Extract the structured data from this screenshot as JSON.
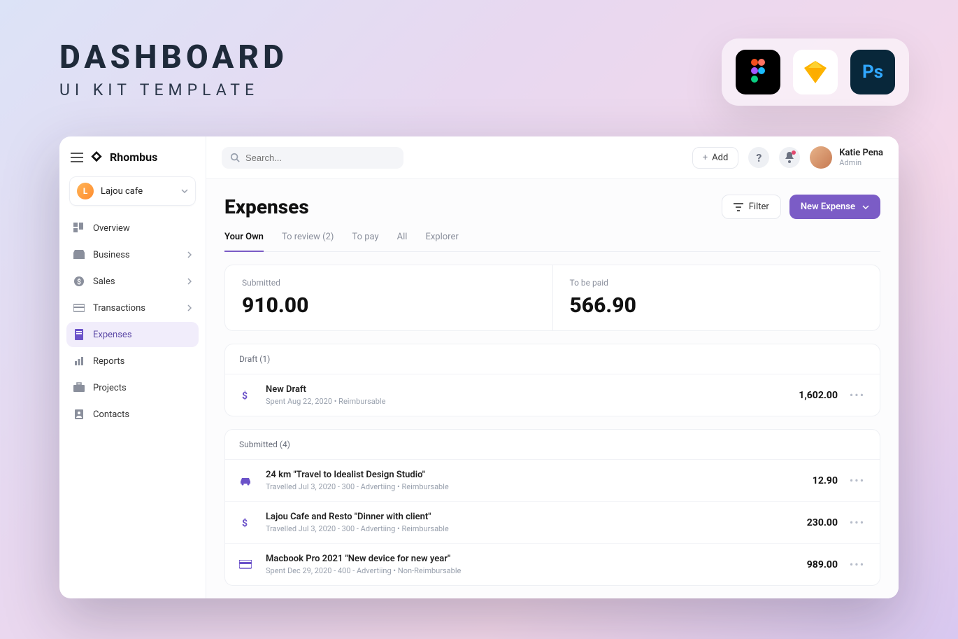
{
  "promo": {
    "title": "DASHBOARD",
    "subtitle": "UI KIT TEMPLATE"
  },
  "brand": {
    "name": "Rhombus"
  },
  "workspace": {
    "name": "Lajou cafe",
    "initial": "L"
  },
  "nav": [
    {
      "label": "Overview"
    },
    {
      "label": "Business"
    },
    {
      "label": "Sales"
    },
    {
      "label": "Transactions"
    },
    {
      "label": "Expenses"
    },
    {
      "label": "Reports"
    },
    {
      "label": "Projects"
    },
    {
      "label": "Contacts"
    }
  ],
  "search": {
    "placeholder": "Search..."
  },
  "topbar": {
    "add": "Add"
  },
  "user": {
    "name": "Katie Pena",
    "role": "Admin"
  },
  "page": {
    "title": "Expenses",
    "filter": "Filter",
    "newExpense": "New Expense"
  },
  "tabs": [
    {
      "label": "Your Own"
    },
    {
      "label": "To review (2)"
    },
    {
      "label": "To pay"
    },
    {
      "label": "All"
    },
    {
      "label": "Explorer"
    }
  ],
  "summary": {
    "submittedLabel": "Submitted",
    "submittedValue": "910.00",
    "tobePaidLabel": "To be paid",
    "tobePaidValue": "566.90"
  },
  "draft": {
    "header": "Draft (1)",
    "items": [
      {
        "title": "New Draft",
        "sub": "Spent Aug 22, 2020  •  Reimbursable",
        "amount": "1,602.00"
      }
    ]
  },
  "submitted": {
    "header": "Submitted (4)",
    "items": [
      {
        "title": "24 km \"Travel to Idealist Design Studio\"",
        "sub": "Travelled Jul 3, 2020 - 300 -  Advertiing  •  Reimbursable",
        "amount": "12.90"
      },
      {
        "title": "Lajou Cafe and Resto \"Dinner with client\"",
        "sub": "Travelled Jul 3, 2020 - 300 -  Advertiing  •  Reimbursable",
        "amount": "230.00"
      },
      {
        "title": "Macbook Pro 2021 \"New device for new year\"",
        "sub": "Spent Dec 29, 2020 - 400 -  Advertiing  •  Non-Reimbursable",
        "amount": "989.00"
      }
    ]
  },
  "appIcons": {
    "ps": "Ps"
  }
}
